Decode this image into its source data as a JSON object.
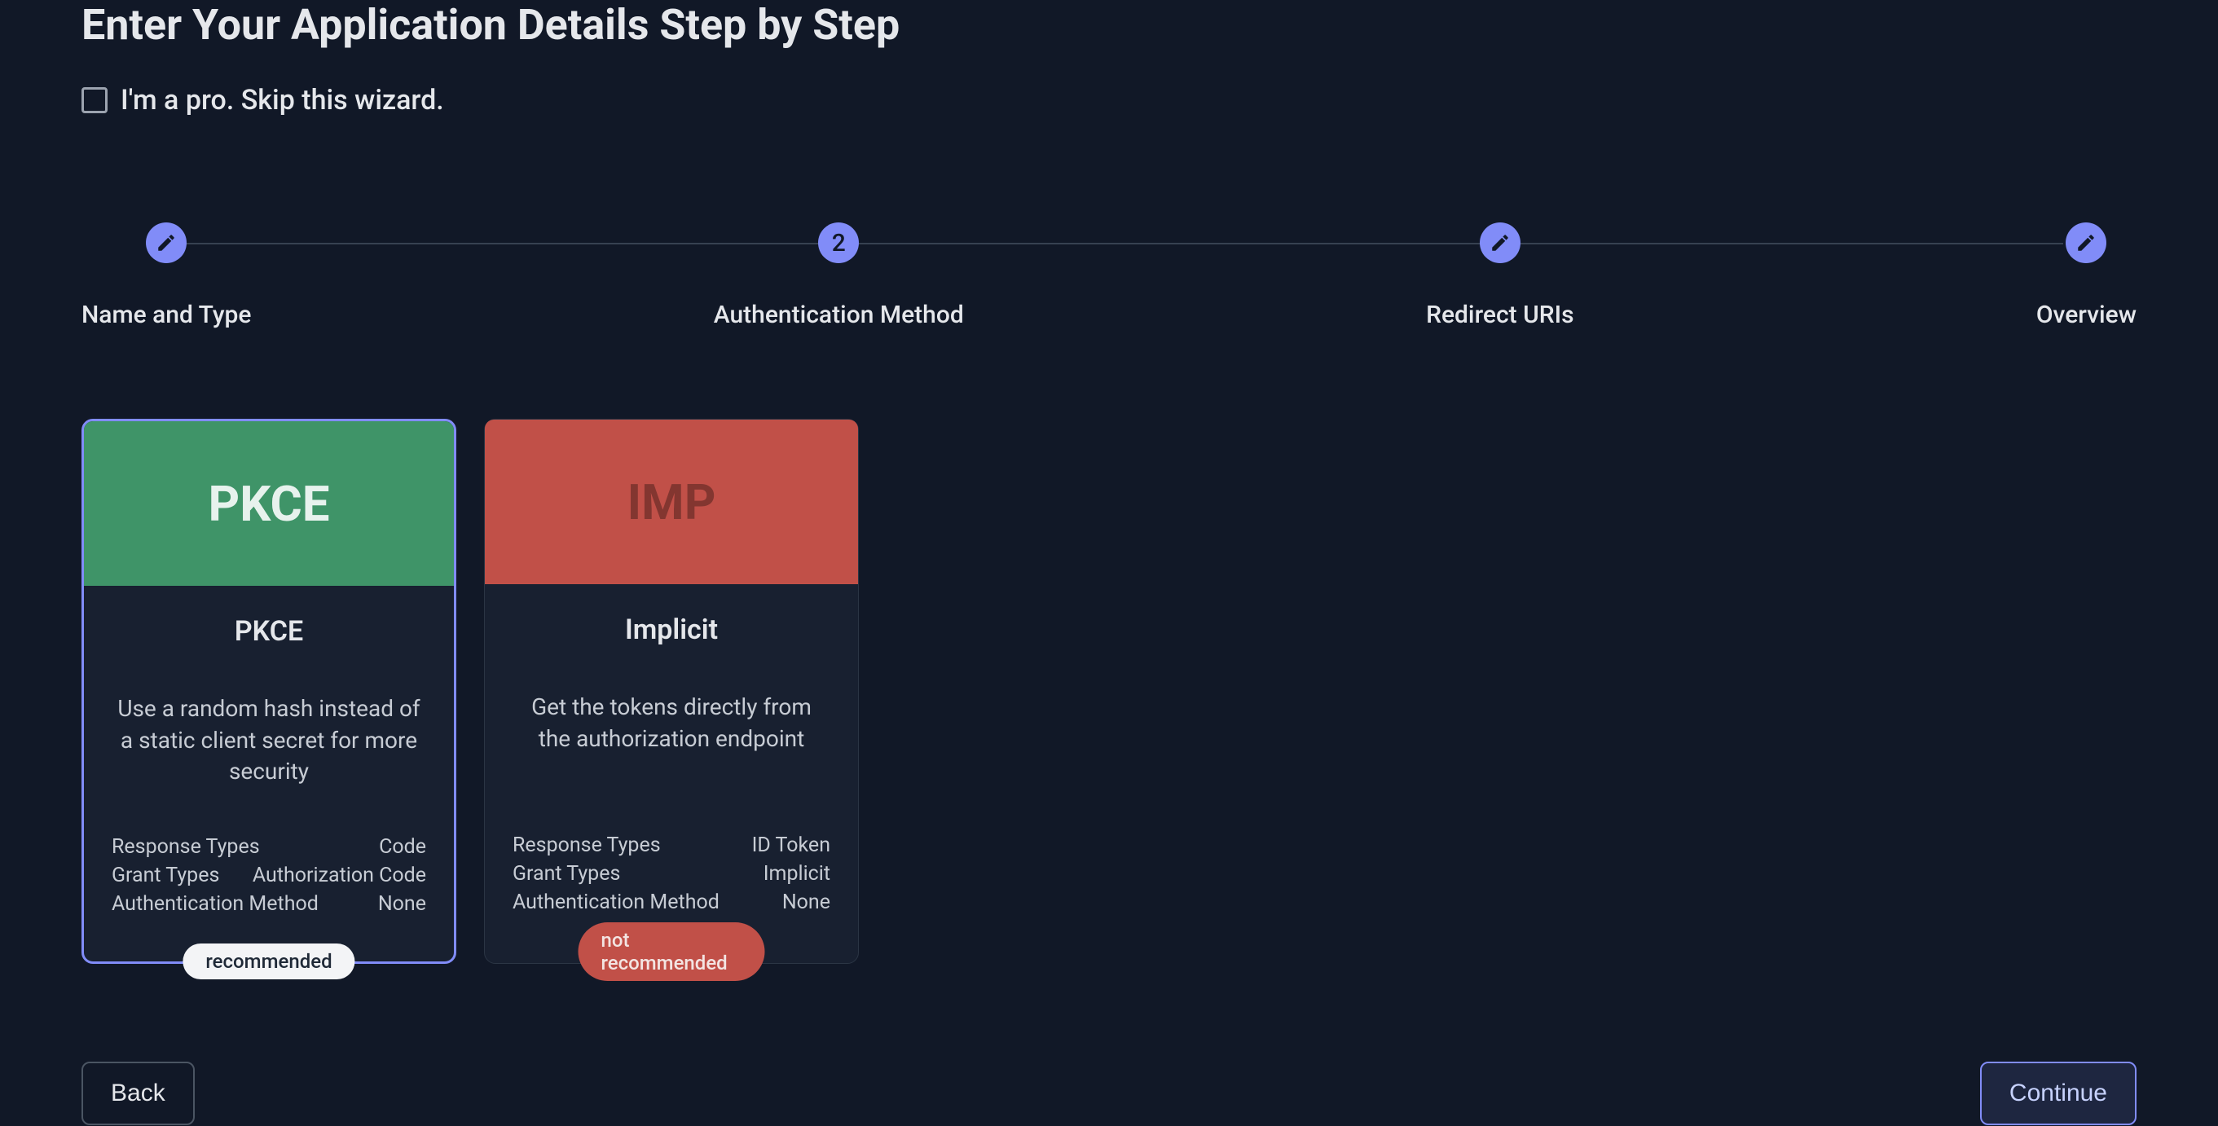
{
  "title": "Enter Your Application Details Step by Step",
  "skip": {
    "label": "I'm a pro. Skip this wizard."
  },
  "stepper": {
    "current_index": 1,
    "steps": [
      {
        "label": "Name and Type",
        "state": "edit"
      },
      {
        "label": "Authentication Method",
        "state": "current",
        "number": "2"
      },
      {
        "label": "Redirect URIs",
        "state": "edit"
      },
      {
        "label": "Overview",
        "state": "edit"
      }
    ]
  },
  "detail_labels": {
    "response_types": "Response Types",
    "grant_types": "Grant Types",
    "auth_method": "Authentication Method"
  },
  "cards": [
    {
      "id": "pkce",
      "selected": true,
      "header_text": "PKCE",
      "header_color": "#3f9468",
      "title": "PKCE",
      "description": "Use a random hash instead of a static client secret for more security",
      "details": {
        "response_types": "Code",
        "grant_types": "Authorization Code",
        "auth_method": "None"
      },
      "badge": {
        "text": "recommended",
        "type": "rec"
      }
    },
    {
      "id": "implicit",
      "selected": false,
      "header_text": "IMP",
      "header_color": "#c15048",
      "title": "Implicit",
      "description": "Get the tokens directly from the authorization endpoint",
      "details": {
        "response_types": "ID Token",
        "grant_types": "Implicit",
        "auth_method": "None"
      },
      "badge": {
        "text": "not recommended",
        "type": "notrec"
      }
    }
  ],
  "footer": {
    "back_label": "Back",
    "continue_label": "Continue"
  }
}
